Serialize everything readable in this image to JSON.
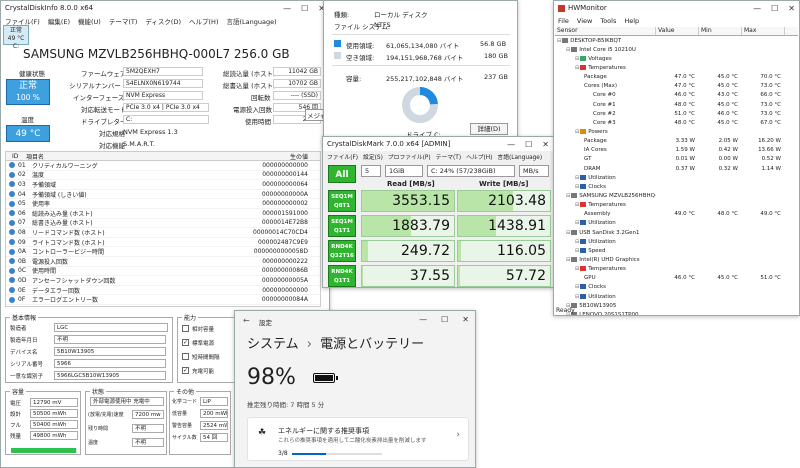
{
  "cdi": {
    "title": "CrystalDiskInfo 8.0.0 x64",
    "menu": [
      "ファイル(F)",
      "編集(E)",
      "機能(U)",
      "テーマ(T)",
      "ディスク(D)",
      "ヘルプ(H)",
      "言語(Language)"
    ],
    "tab_status": "正常",
    "tab_temp": "49 °C",
    "tab_drive": "C:",
    "model": "SAMSUNG MZVLB256HBHQ-000L7 256.0 GB",
    "health_label": "健康状態",
    "health_status": "正常",
    "health_pct": "100 %",
    "temp_label": "温度",
    "temp_value": "49 °C",
    "firmware_label": "ファームウェア",
    "firmware": "5M2QEXH7",
    "serial_label": "シリアルナンバー",
    "serial": "S4ELNX0N619744",
    "interface_label": "インターフェース",
    "interface": "NVM Express",
    "transfer_label": "対応転送モード",
    "transfer": "PCIe 3.0 x4 | PCIe 3.0 x4",
    "letter_label": "ドライブレター",
    "letter": "C:",
    "standard_label": "対応規格",
    "standard": "NVM Express 1.3",
    "features_label": "対応機能",
    "features": "S.M.A.R.T.",
    "hr_label": "総読込量 (ホスト)",
    "hr": "11042 GB",
    "hw_label": "総書込量 (ホスト)",
    "hw": "10702 GB",
    "rot_label": "回転数",
    "rot": "---- (SSD)",
    "poc_label": "電源投入回数",
    "poc": "546 回",
    "poh_label": "使用時間",
    "poh": "2155",
    "tooltip": "メジャ",
    "smart_headers": [
      "ID",
      "項目名",
      "生の値"
    ],
    "smart": [
      {
        "id": "01",
        "name": "クリティカルワーニング",
        "raw": "000000000000"
      },
      {
        "id": "02",
        "name": "温度",
        "raw": "000000000144"
      },
      {
        "id": "03",
        "name": "予備領域",
        "raw": "000000000064"
      },
      {
        "id": "04",
        "name": "予備領域 (しきい値)",
        "raw": "00000000000A"
      },
      {
        "id": "05",
        "name": "使用率",
        "raw": "000000000002"
      },
      {
        "id": "06",
        "name": "総読み込み量 (ホスト)",
        "raw": "000001591000"
      },
      {
        "id": "07",
        "name": "総書き込み量 (ホスト)",
        "raw": "0000014E72B8"
      },
      {
        "id": "08",
        "name": "リードコマンド数 (ホスト)",
        "raw": "00000014C70CD4"
      },
      {
        "id": "09",
        "name": "ライトコマンド数 (ホスト)",
        "raw": "000002487C9E9"
      },
      {
        "id": "0A",
        "name": "コントローラービジー時間",
        "raw": "0000000000058D"
      },
      {
        "id": "0B",
        "name": "電源投入回数",
        "raw": "000000000222"
      },
      {
        "id": "0C",
        "name": "使用時間",
        "raw": "00000000086B"
      },
      {
        "id": "0D",
        "name": "アンセーフシャットダウン回数",
        "raw": "00000000005A"
      },
      {
        "id": "0E",
        "name": "データエラー回数",
        "raw": "000000000000"
      },
      {
        "id": "0F",
        "name": "エラーログエントリー数",
        "raw": "00000000084A"
      }
    ],
    "basic_group": "基本情報",
    "basic": [
      {
        "label": "製造者",
        "value": "LGC"
      },
      {
        "label": "製造年月日",
        "value": "不明"
      },
      {
        "label": "デバイス名",
        "value": "5B10W13905"
      },
      {
        "label": "シリアル番号",
        "value": "5966"
      },
      {
        "label": "一意な識別子",
        "value": "5966LGC5B10W13905"
      }
    ],
    "func_group": "能力",
    "funcs": [
      {
        "label": "相対容量",
        "checked": false
      },
      {
        "label": "標準電源",
        "checked": true
      },
      {
        "label": "短時間間隔",
        "checked": false
      },
      {
        "label": "充電可能",
        "checked": true
      }
    ],
    "cap_group": "容量",
    "caps": [
      {
        "label": "電圧",
        "value": "12790 mV"
      },
      {
        "label": "設計",
        "value": "50500 mWh"
      },
      {
        "label": "フル",
        "value": "50400 mWh"
      },
      {
        "label": "残量",
        "value": "49800 mWh"
      }
    ],
    "state_group": "状態",
    "state_value": "外部電源使用中 充電中",
    "states": [
      {
        "label": "(放電/充電)速度",
        "value": "7200 mw"
      },
      {
        "label": "残り時間",
        "value": "不明"
      },
      {
        "label": "温度",
        "value": "不明"
      }
    ],
    "other_group": "その他",
    "others": [
      {
        "label": "化学コード",
        "value": "LiP"
      },
      {
        "label": "低容量",
        "value": "200 mWh"
      },
      {
        "label": "警告容量",
        "value": "2524 mWh"
      },
      {
        "label": "サイクル数",
        "value": "54 回"
      }
    ],
    "charge_level": 0.986
  },
  "prop": {
    "type_label": "種類:",
    "type": "ローカル ディスク",
    "fs_label": "ファイル システム:",
    "fs": "NTFS",
    "used_label": "使用領域:",
    "used_bytes": "61,065,134,080 バイト",
    "used_gb": "56.8 GB",
    "free_label": "空き領域:",
    "free_bytes": "194,151,968,768 バイト",
    "free_gb": "180 GB",
    "cap_label": "容量:",
    "cap_bytes": "255,217,102,848 バイト",
    "cap_gb": "237 GB",
    "drive_label": "ドライブ C:",
    "detail_button": "詳細(D)",
    "used_fraction": 0.239,
    "used_color": "#1f8ae0",
    "free_color": "#cfd8e0"
  },
  "cdm": {
    "title": "CrystalDiskMark 7.0.0 x64 [ADMIN]",
    "menu": [
      "ファイル(F)",
      "設定(S)",
      "プロファイル(P)",
      "テーマ(T)",
      "ヘルプ(H)",
      "言語(Language)"
    ],
    "all_button": "All",
    "count": "5",
    "size": "1GiB",
    "drive": "C: 24% (57/238GiB)",
    "unit": "MB/s",
    "read_header": "Read [MB/s]",
    "write_header": "Write [MB/s]",
    "rows": [
      {
        "label1": "SEQ1M",
        "label2": "Q8T1",
        "read": "3553.15",
        "write": "2103.48",
        "rf": 1.0,
        "wf": 0.6
      },
      {
        "label1": "SEQ1M",
        "label2": "Q1T1",
        "read": "1883.79",
        "write": "1438.91",
        "rf": 0.53,
        "wf": 0.41
      },
      {
        "label1": "RND4K",
        "label2": "Q32T16",
        "read": "249.72",
        "write": "116.05",
        "rf": 0.07,
        "wf": 0.03
      },
      {
        "label1": "RND4K",
        "label2": "Q1T1",
        "read": "37.55",
        "write": "57.72",
        "rf": 0.01,
        "wf": 0.02
      }
    ]
  },
  "hwm": {
    "title": "HWMonitor",
    "menu": [
      "File",
      "View",
      "Tools",
      "Help"
    ],
    "headers": [
      "Sensor",
      "Value",
      "Min",
      "Max"
    ],
    "rows": [
      {
        "indent": 0,
        "name": "DESKTOP-B5IKBQT",
        "v": "",
        "mn": "",
        "mx": ""
      },
      {
        "indent": 1,
        "name": "Intel Core i5 10210U",
        "v": "",
        "mn": "",
        "mx": ""
      },
      {
        "indent": 2,
        "name": "Voltages",
        "v": "",
        "mn": "",
        "mx": ""
      },
      {
        "indent": 2,
        "name": "Temperatures",
        "v": "",
        "mn": "",
        "mx": ""
      },
      {
        "indent": 3,
        "name": "Package",
        "v": "47.0 °C",
        "mn": "45.0 °C",
        "mx": "70.0 °C"
      },
      {
        "indent": 3,
        "name": "Cores (Max)",
        "v": "47.0 °C",
        "mn": "45.0 °C",
        "mx": "73.0 °C"
      },
      {
        "indent": 4,
        "name": "Core #0",
        "v": "46.0 °C",
        "mn": "43.0 °C",
        "mx": "66.0 °C"
      },
      {
        "indent": 4,
        "name": "Core #1",
        "v": "48.0 °C",
        "mn": "45.0 °C",
        "mx": "73.0 °C"
      },
      {
        "indent": 4,
        "name": "Core #2",
        "v": "51.0 °C",
        "mn": "46.0 °C",
        "mx": "73.0 °C"
      },
      {
        "indent": 4,
        "name": "Core #3",
        "v": "48.0 °C",
        "mn": "45.0 °C",
        "mx": "67.0 °C"
      },
      {
        "indent": 2,
        "name": "Powers",
        "v": "",
        "mn": "",
        "mx": ""
      },
      {
        "indent": 3,
        "name": "Package",
        "v": "3.33 W",
        "mn": "2.05 W",
        "mx": "16.20 W"
      },
      {
        "indent": 3,
        "name": "IA Cores",
        "v": "1.59 W",
        "mn": "0.42 W",
        "mx": "13.66 W"
      },
      {
        "indent": 3,
        "name": "GT",
        "v": "0.01 W",
        "mn": "0.00 W",
        "mx": "0.52 W"
      },
      {
        "indent": 3,
        "name": "DRAM",
        "v": "0.37 W",
        "mn": "0.32 W",
        "mx": "1.14 W"
      },
      {
        "indent": 2,
        "name": "Utilization",
        "v": "",
        "mn": "",
        "mx": ""
      },
      {
        "indent": 2,
        "name": "Clocks",
        "v": "",
        "mn": "",
        "mx": ""
      },
      {
        "indent": 1,
        "name": "SAMSUNG MZVLB256HBHQ-00...",
        "v": "",
        "mn": "",
        "mx": ""
      },
      {
        "indent": 2,
        "name": "Temperatures",
        "v": "",
        "mn": "",
        "mx": ""
      },
      {
        "indent": 3,
        "name": "Assembly",
        "v": "49.0 °C",
        "mn": "48.0 °C",
        "mx": "49.0 °C"
      },
      {
        "indent": 2,
        "name": "Utilization",
        "v": "",
        "mn": "",
        "mx": ""
      },
      {
        "indent": 1,
        "name": "USB SanDisk 3.2Gen1",
        "v": "",
        "mn": "",
        "mx": ""
      },
      {
        "indent": 2,
        "name": "Utilization",
        "v": "",
        "mn": "",
        "mx": ""
      },
      {
        "indent": 2,
        "name": "Speed",
        "v": "",
        "mn": "",
        "mx": ""
      },
      {
        "indent": 1,
        "name": "Intel(R) UHD Graphics",
        "v": "",
        "mn": "",
        "mx": ""
      },
      {
        "indent": 2,
        "name": "Temperatures",
        "v": "",
        "mn": "",
        "mx": ""
      },
      {
        "indent": 3,
        "name": "GPU",
        "v": "46.0 °C",
        "mn": "45.0 °C",
        "mx": "51.0 °C"
      },
      {
        "indent": 2,
        "name": "Clocks",
        "v": "",
        "mn": "",
        "mx": ""
      },
      {
        "indent": 2,
        "name": "Utilization",
        "v": "",
        "mn": "",
        "mx": ""
      },
      {
        "indent": 1,
        "name": "5B10W13905",
        "v": "",
        "mn": "",
        "mx": ""
      },
      {
        "indent": 1,
        "name": "LENOVO 20S1S1TP00",
        "v": "",
        "mn": "",
        "mx": ""
      }
    ],
    "status": "Ready"
  },
  "settings": {
    "app": "設定",
    "crumb1": "システム",
    "sep": "›",
    "crumb2": "電源とバッテリー",
    "battery_pct": "98%",
    "remaining": "推定残り時間: 7 時間 5 分",
    "rec_title": "エネルギーに関する推奨事項",
    "rec_desc": "これらの推奨事項を適用して二酸化炭素排出量を削減します",
    "progress": "3/8",
    "progress_fraction": 0.375
  }
}
